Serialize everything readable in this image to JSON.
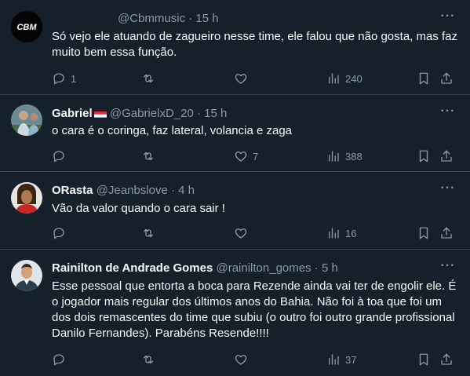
{
  "tweets": [
    {
      "name": "",
      "handle": "@Cbmmusic",
      "time": "15 h",
      "avatar_text": "CBM",
      "body": "Só vejo ele atuando de zagueiro nesse time, ele falou que não gosta, mas faz muito bem essa função.",
      "replies": "1",
      "retweets": "",
      "likes": "",
      "views": "240"
    },
    {
      "name": "Gabriel",
      "handle": "@GabrielxD_20",
      "time": "15 h",
      "body": "o cara é o coringa, faz lateral, volancia e zaga",
      "replies": "",
      "retweets": "",
      "likes": "7",
      "views": "388"
    },
    {
      "name": "ORasta",
      "handle": "@Jeanbslove",
      "time": "4 h",
      "body": "Vão da valor quando o cara sair !",
      "replies": "",
      "retweets": "",
      "likes": "",
      "views": "16"
    },
    {
      "name": "Rainilton de Andrade Gomes",
      "handle": "@rainilton_gomes",
      "time": "5 h",
      "body": "Esse pessoal que entorta a boca para Rezende ainda vai ter de engolir ele. É o jogador mais regular dos últimos anos do Bahia. Não foi à toa que foi um dos dois remascentes do time que subiu (o outro foi outro grande profissional Danilo Fernandes). Parabéns Resende!!!!",
      "replies": "",
      "retweets": "",
      "likes": "",
      "views": "37"
    }
  ],
  "colors": {
    "background": "#15202b",
    "divider": "#38444d",
    "secondary_text": "#8b98a5",
    "primary_text": "#f7f9f9"
  },
  "icons": [
    "reply-icon",
    "retweet-icon",
    "like-icon",
    "views-icon",
    "bookmark-icon",
    "share-icon",
    "more-icon",
    "flag-icon"
  ]
}
